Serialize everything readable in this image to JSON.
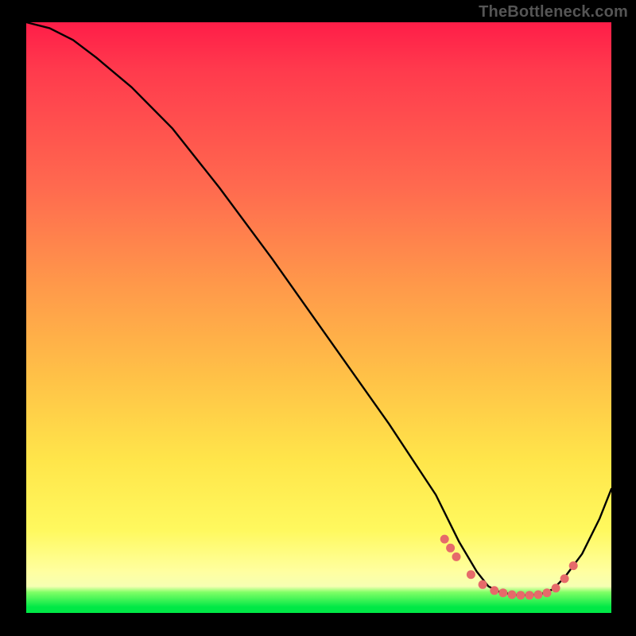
{
  "watermark": "TheBottleneck.com",
  "chart_data": {
    "type": "line",
    "title": "",
    "xlabel": "",
    "ylabel": "",
    "xlim": [
      0,
      100
    ],
    "ylim": [
      0,
      100
    ],
    "grid": false,
    "legend": false,
    "annotations": [],
    "series": [
      {
        "name": "bottleneck-curve",
        "x": [
          0,
          4,
          8,
          12,
          18,
          25,
          33,
          42,
          52,
          62,
          70,
          74,
          77,
          79,
          81,
          84,
          86,
          88,
          90,
          92,
          95,
          98,
          100
        ],
        "y": [
          100,
          99,
          97,
          94,
          89,
          82,
          72,
          60,
          46,
          32,
          20,
          12,
          7,
          4.5,
          3.5,
          3.0,
          3.0,
          3.2,
          4.0,
          6.0,
          10,
          16,
          21
        ]
      }
    ],
    "highlight_points": {
      "name": "dots",
      "x": [
        71.5,
        72.5,
        73.5,
        76,
        78,
        80,
        81.5,
        83,
        84.5,
        86,
        87.5,
        89,
        90.5,
        92,
        93.5
      ],
      "y": [
        12.5,
        11.0,
        9.5,
        6.5,
        4.8,
        3.8,
        3.4,
        3.1,
        3.0,
        3.0,
        3.1,
        3.4,
        4.2,
        5.8,
        8.0
      ]
    },
    "gradient_bands": [
      {
        "color": "#ff1d48",
        "at": 0
      },
      {
        "color": "#ff6a4f",
        "at": 28
      },
      {
        "color": "#ffc147",
        "at": 60
      },
      {
        "color": "#fff95e",
        "at": 86
      },
      {
        "color": "#00e846",
        "at": 99
      }
    ]
  }
}
